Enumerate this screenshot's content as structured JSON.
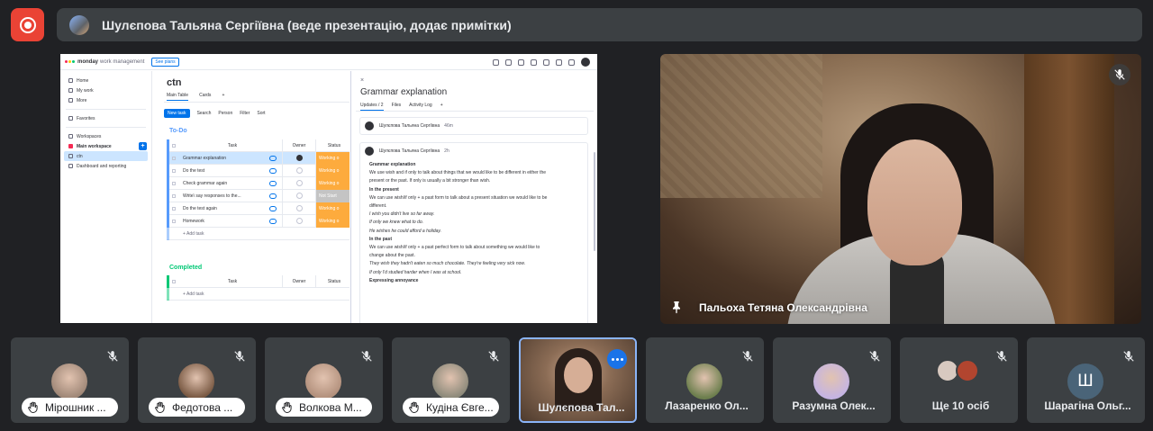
{
  "presenter": {
    "text": "Шулєпова Тальяна Сергіївна (веде презентацію, додає примітки)"
  },
  "shared_screen": {
    "brand": "monday",
    "brand_sub": "work management",
    "see_plans": "See plans",
    "nav": {
      "home": "Home",
      "my_work": "My work",
      "more": "More",
      "favorites": "Favorites",
      "workspaces": "Workspaces",
      "main_workspace": "Main workspace",
      "board": "ctn",
      "dashboard": "Dashboard and reporting"
    },
    "board": {
      "title": "ctn",
      "tab_main": "Main Table",
      "tab_cards": "Cards",
      "tab_add": "+",
      "new_task": "New task",
      "search": "Search",
      "person": "Person",
      "filter": "Filter",
      "sort": "Sort",
      "group_todo": "To-Do",
      "group_done": "Completed",
      "col_task": "Task",
      "col_owner": "Owner",
      "col_status": "Status",
      "add_task": "+ Add task",
      "rows": [
        {
          "task": "Grammar explanation",
          "status": "Working o"
        },
        {
          "task": "Do the test",
          "status": "Working o"
        },
        {
          "task": "Check grammar again",
          "status": "Working o"
        },
        {
          "task": "Write\\ say responses to the...",
          "status": "Not Start"
        },
        {
          "task": "Do the test again",
          "status": "Working o"
        },
        {
          "task": "Homework",
          "status": "Working o"
        }
      ]
    },
    "panel": {
      "close": "×",
      "title": "Grammar explanation",
      "tab_updates": "Updates / 2",
      "tab_files": "Files",
      "tab_activity": "Activity Log",
      "tab_add": "+",
      "post1_author": "Шулєпова Тальяна Сергіївна",
      "post1_time": "46m",
      "post2_author": "Шулєпова Тальяна Сергіївна",
      "post2_time": "2h",
      "lines": [
        {
          "text": "Grammar explanation",
          "style": "b"
        },
        {
          "text": "We use wish and if only to talk about things that we would like to be different in either the",
          "style": ""
        },
        {
          "text": "present or the past. If only is usually a bit stronger than wish.",
          "style": ""
        },
        {
          "text": "In the present",
          "style": "b"
        },
        {
          "text": "We can use wish/if only + a past form to talk about a present situation we would like to be",
          "style": ""
        },
        {
          "text": "different.",
          "style": ""
        },
        {
          "text": "I wish you didn't live so far away.",
          "style": "i"
        },
        {
          "text": "If only we knew what to do.",
          "style": "i"
        },
        {
          "text": "He wishes he could afford a holiday.",
          "style": "i"
        },
        {
          "text": "In the past",
          "style": "b"
        },
        {
          "text": "We can use wish/if only + a past perfect form to talk about something we would like to",
          "style": ""
        },
        {
          "text": "change about the past.",
          "style": ""
        },
        {
          "text": "They wish they hadn't eaten so much chocolate. They're feeling very sick now.",
          "style": "i"
        },
        {
          "text": "If only I'd studied harder when I was at school.",
          "style": "i"
        },
        {
          "text": "Expressing annoyance",
          "style": "b"
        }
      ]
    }
  },
  "main_speaker": {
    "name": "Пальоха Тетяна Олександрівна"
  },
  "tiles": [
    {
      "name": "Мірошник ...",
      "hand": true
    },
    {
      "name": "Федотова ...",
      "hand": true
    },
    {
      "name": "Волкова М...",
      "hand": true
    },
    {
      "name": "Кудіна Євге...",
      "hand": true
    },
    {
      "name": "Шулєпова Тал...",
      "self": true
    },
    {
      "name": "Лазаренко Ол..."
    },
    {
      "name": "Разумна Олек..."
    },
    {
      "name": "Ще 10 осіб"
    },
    {
      "name": "Шарагіна Ольг...",
      "letter": "Ш"
    }
  ],
  "colors": {
    "record": "#ea4335",
    "accent": "#1a73e8",
    "status_working": "#fdab3d",
    "status_not_started": "#c4c4c4",
    "monday_blue": "#0073ea"
  },
  "icons": [
    "record-icon",
    "mic-off-icon",
    "pin-icon",
    "raised-hand-icon",
    "more-options-icon"
  ]
}
